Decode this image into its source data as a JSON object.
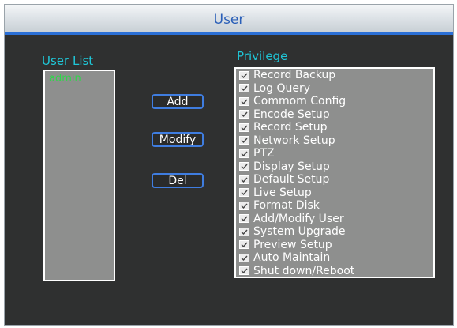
{
  "window": {
    "title": "User"
  },
  "user_list": {
    "label": "User List",
    "users": [
      "admin"
    ]
  },
  "buttons": {
    "add": "Add",
    "modify": "Modify",
    "del": "Del"
  },
  "privilege": {
    "label": "Privilege",
    "items": [
      "Record Backup",
      "Log Query",
      "Commom Config",
      "Encode Setup",
      "Record Setup",
      "Network Setup",
      "PTZ",
      "Display Setup",
      "Default Setup",
      "Live Setup",
      "Format Disk",
      "Add/Modify User",
      "System Upgrade",
      "Preview Setup",
      "Auto Maintain",
      "Shut down/Reboot"
    ]
  },
  "colors": {
    "title_text": "#2a5fb8",
    "title_underline": "#2a6fd6",
    "panel_bg": "#2f3030",
    "list_bg": "#8e8f8e",
    "label_cyan": "#1fc7d8",
    "user_green": "#2fd64a",
    "button_border": "#3f7de0"
  }
}
